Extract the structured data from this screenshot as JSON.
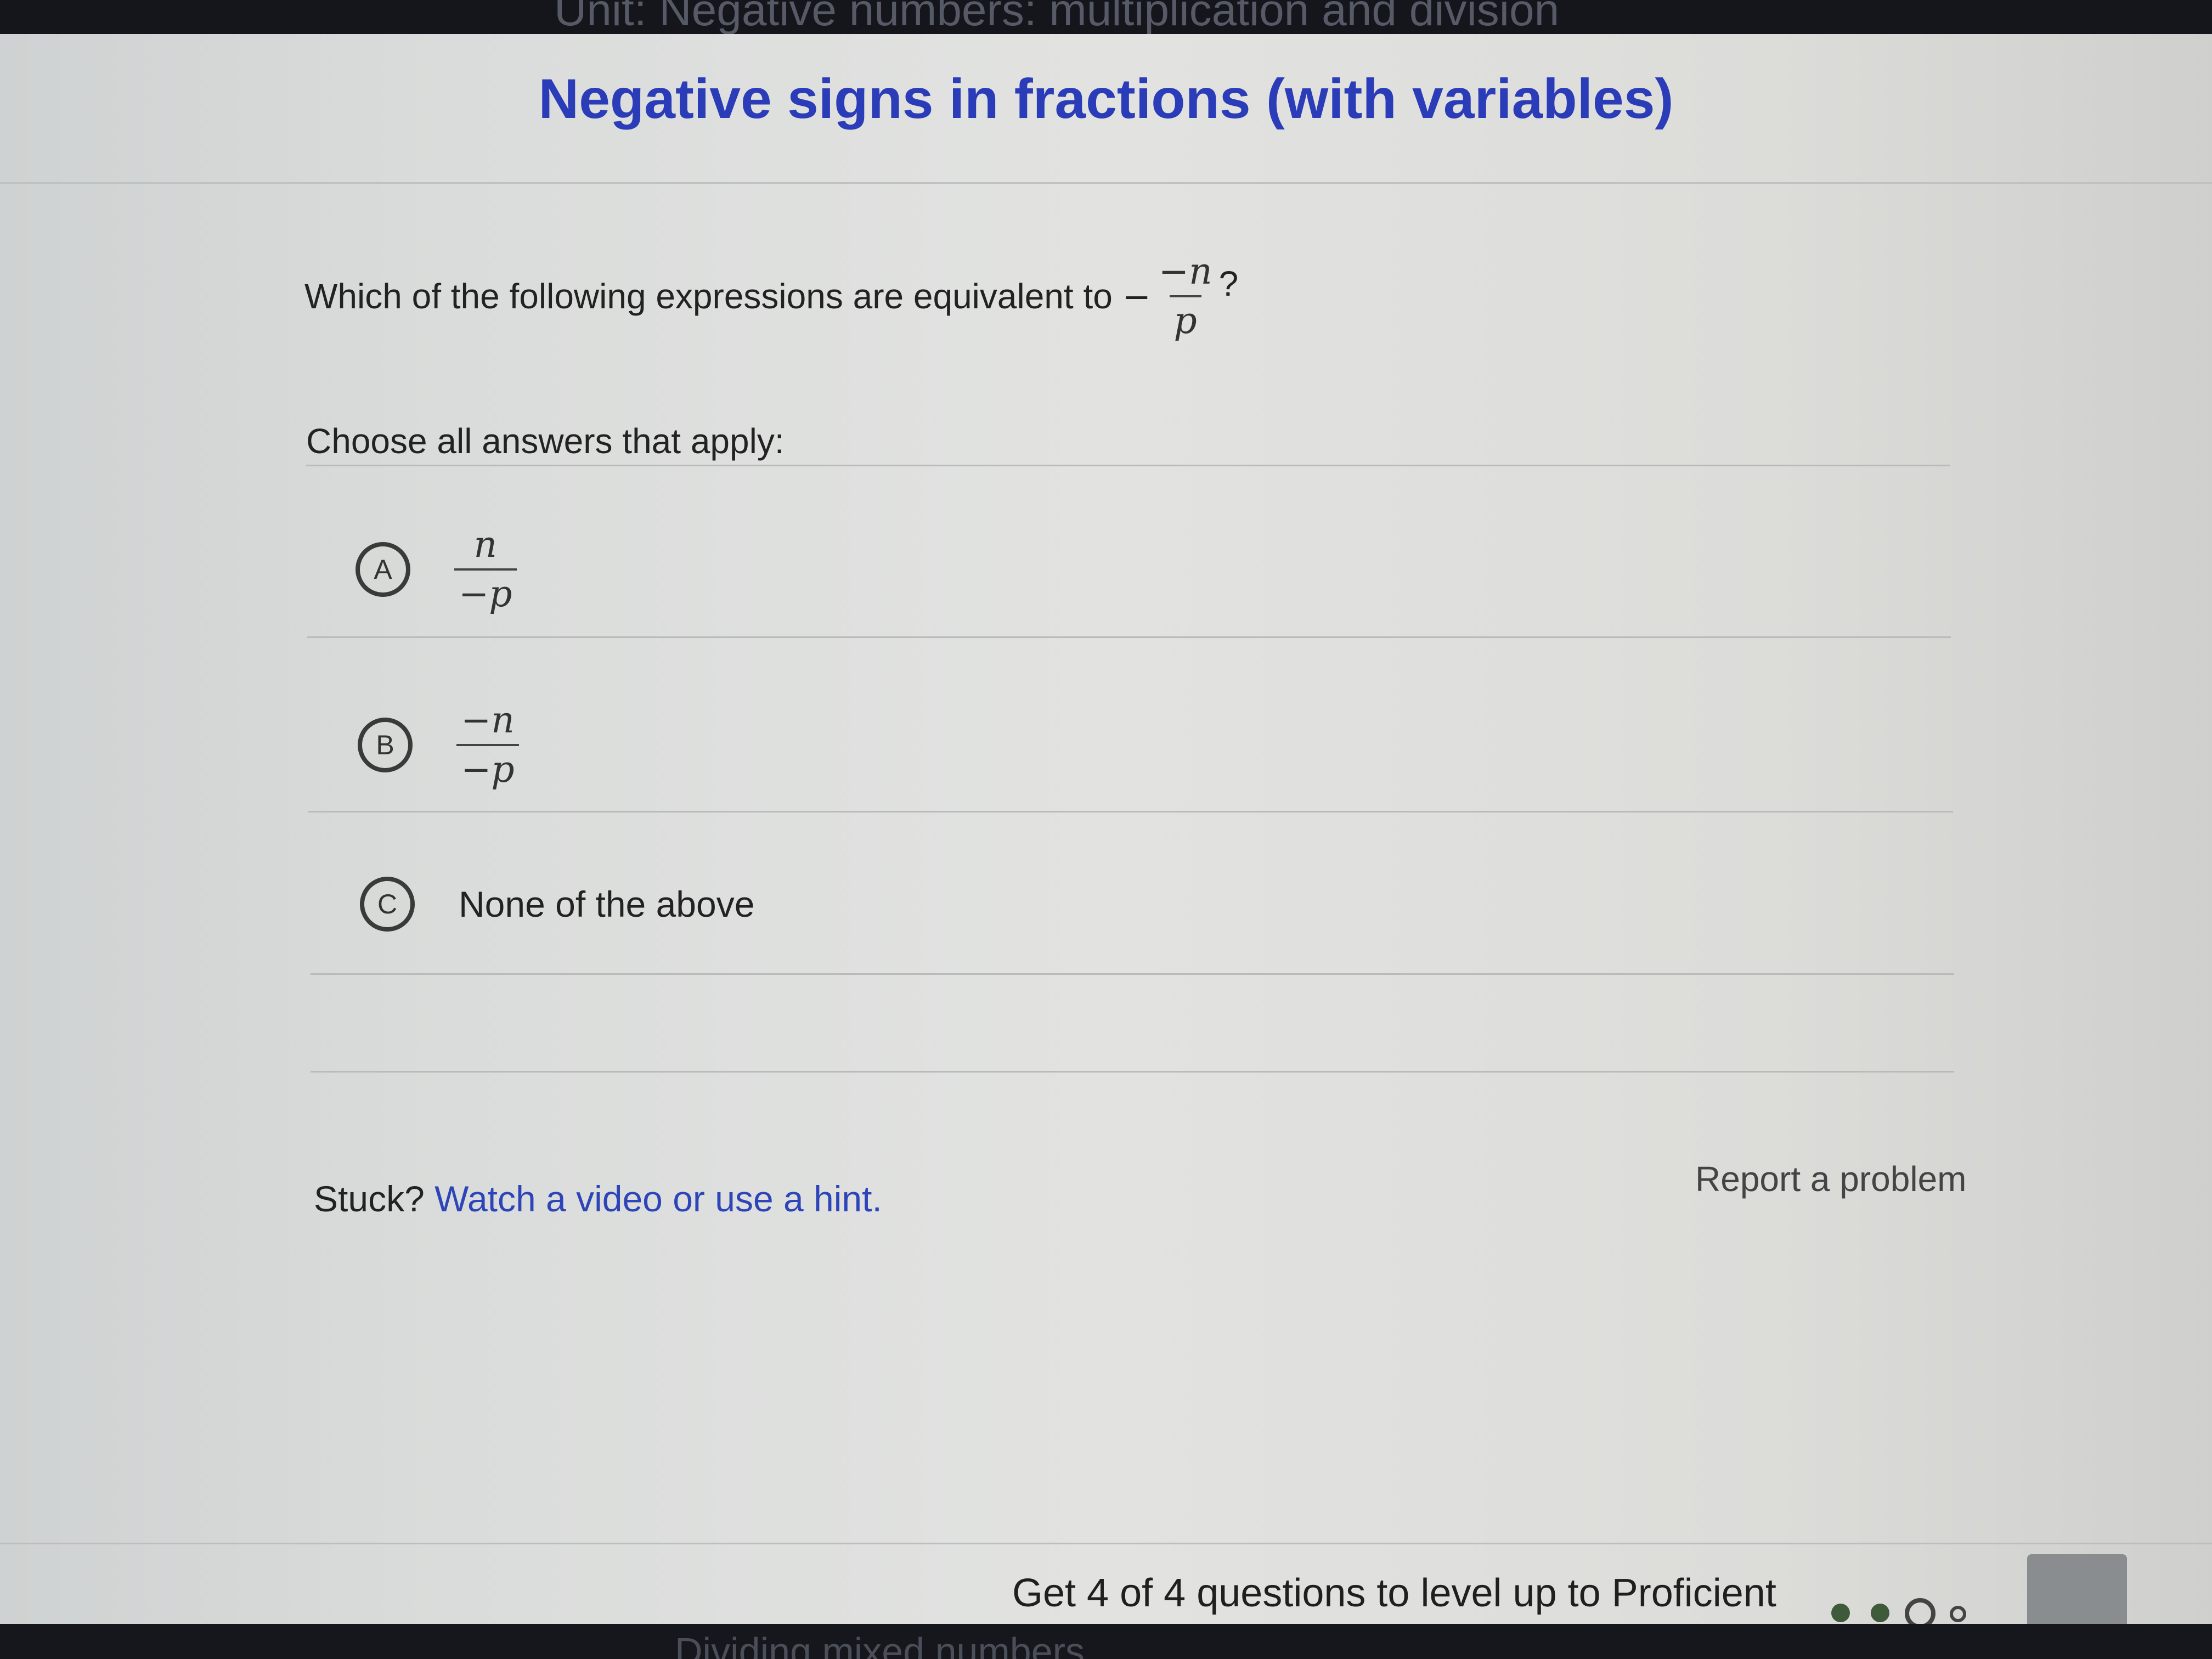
{
  "header": {
    "unit_label": "Unit: Negative numbers: multiplication and division"
  },
  "exercise": {
    "title": "Negative signs in fractions (with variables)",
    "question": {
      "prompt": "Which of the following expressions are equivalent to",
      "expression": {
        "sign": "−",
        "numerator": "−n",
        "denominator": "p"
      },
      "end_mark": "?"
    },
    "instructions": "Choose all answers that apply:",
    "choices": [
      {
        "letter": "A",
        "numerator": "n",
        "denominator": "−p"
      },
      {
        "letter": "B",
        "numerator": "−n",
        "denominator": "−p"
      },
      {
        "letter": "C",
        "text": "None of the above"
      }
    ],
    "help": {
      "stuck_label": "Stuck?",
      "hint_link": "Watch a video or use a hint."
    },
    "report_link": "Report a problem"
  },
  "footer": {
    "progress_text": "Get 4 of 4 questions to level up to Proficient",
    "progress": {
      "completed": 2,
      "total": 4
    },
    "colors": {
      "done": "#3f5a3a",
      "pending_ring": "#444444"
    }
  },
  "bottom": {
    "next_label": "Dividing mixed numbers"
  }
}
